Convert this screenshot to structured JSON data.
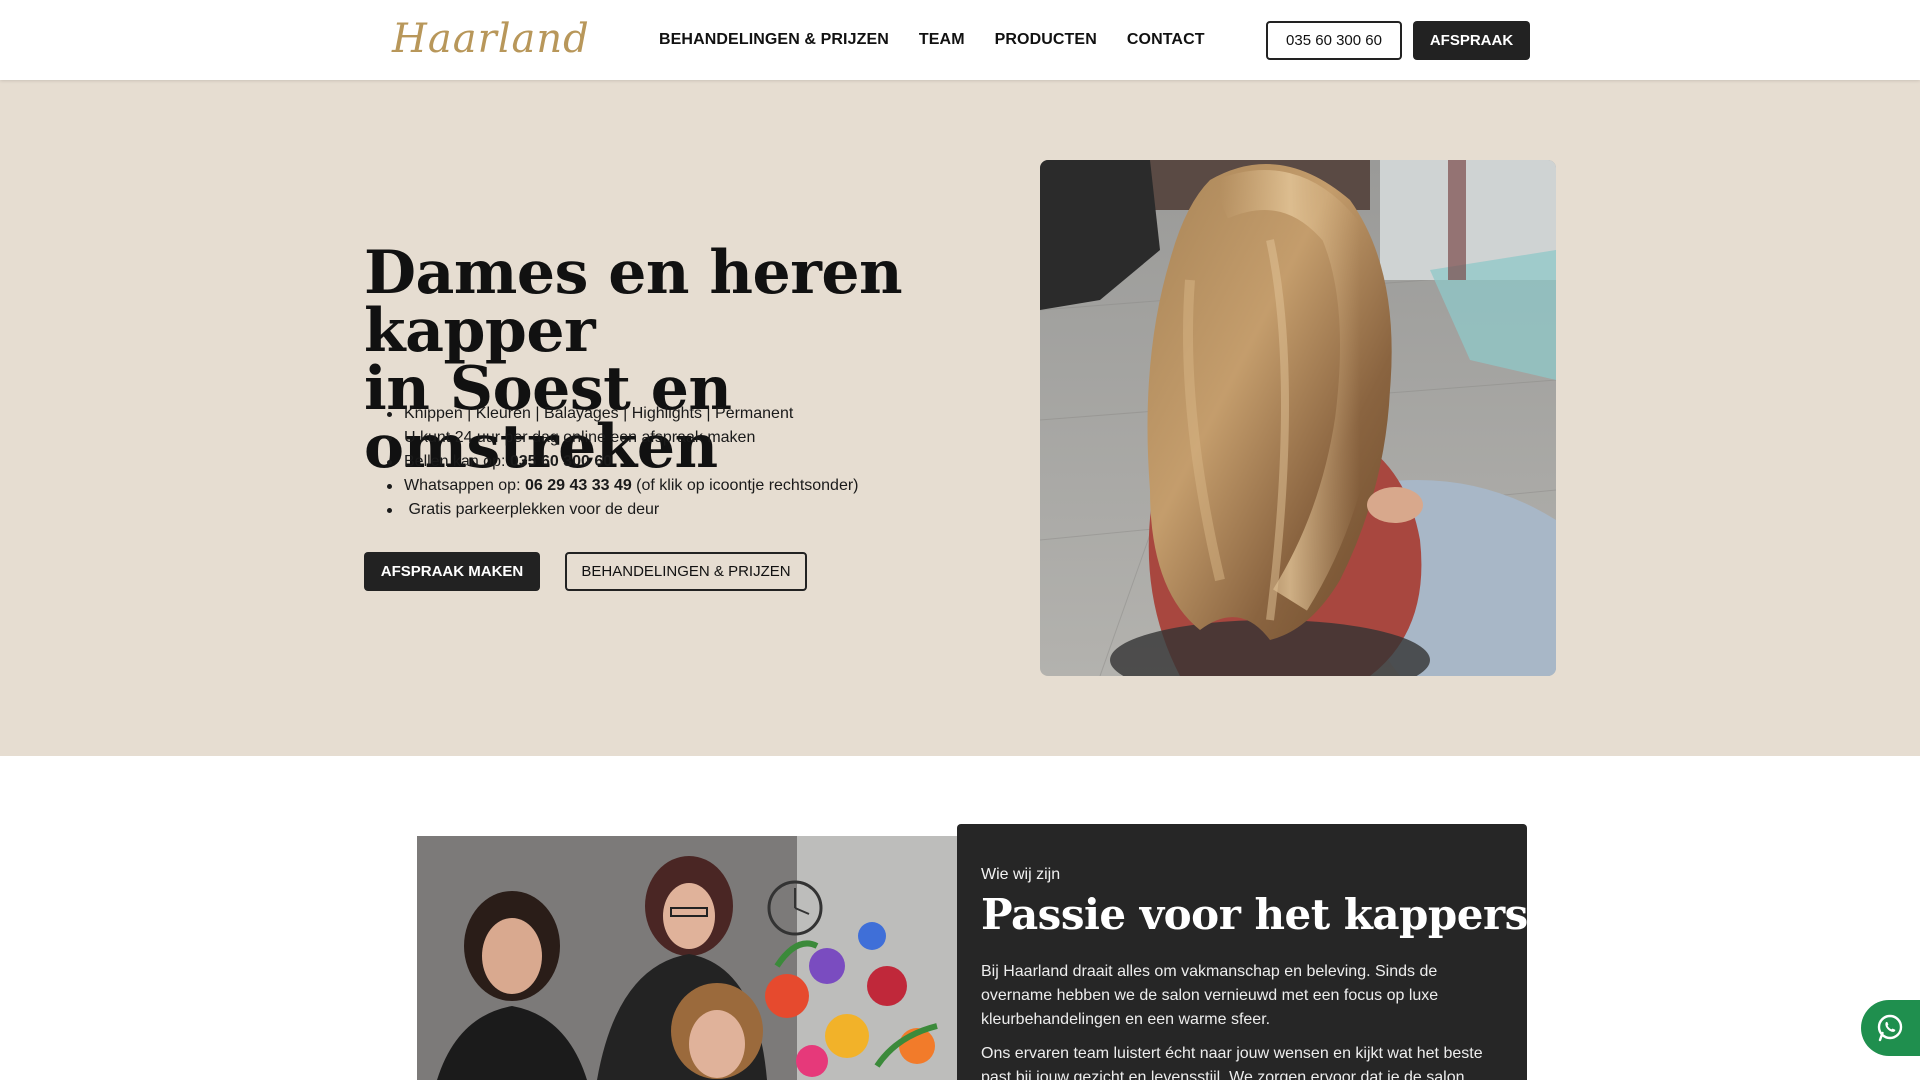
{
  "header": {
    "logo_text": "Haarland",
    "nav": [
      "BEHANDELINGEN & PRIJZEN",
      "TEAM",
      "PRODUCTEN",
      "CONTACT"
    ],
    "phone_button": "035 60 300 60",
    "appointment_button": "AFSPRAAK"
  },
  "hero": {
    "title_line1": "Dames en heren kapper",
    "title_line2": "in Soest en omstreken",
    "bullets": [
      {
        "text": "Knippen | Kleuren | Balayages | Highlights | Permanent"
      },
      {
        "text": "U kunt 24 uur per dag online een afspraak maken"
      },
      {
        "prefix": "Bellen kan op: ",
        "bold": "035 60 300 60",
        "suffix": ""
      },
      {
        "prefix": "Whatsappen op: ",
        "bold": "06 29 43 33 49",
        "suffix": " (of klik op icoontje rechtsonder)"
      },
      {
        "text": " Gratis parkeerplekken voor de deur"
      }
    ],
    "cta_primary": "AFSPRAAK MAKEN",
    "cta_secondary": "BEHANDELINGEN & PRIJZEN"
  },
  "about": {
    "eyebrow": "Wie wij zijn",
    "title": "Passie voor het kappersvak",
    "paragraph1": "Bij Haarland draait alles om vakmanschap en beleving. Sinds de overname hebben we de salon vernieuwd met een focus op luxe kleurbehandelingen en een warme sfeer.",
    "paragraph2": "Ons ervaren team luistert écht naar jouw wensen en kijkt wat het beste past bij jouw gezicht en levensstijl. We zorgen ervoor dat je de salon verlaat"
  },
  "colors": {
    "hero_bg": "#e6ddd1",
    "dark": "#222222",
    "logo_gold": "#b8975a",
    "whatsapp_green": "#1f8f4e"
  },
  "icons": [
    "whatsapp-icon"
  ]
}
